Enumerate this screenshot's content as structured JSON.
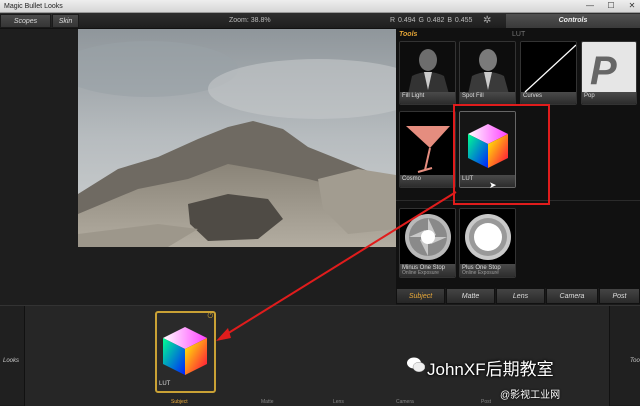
{
  "window": {
    "title": "Magic Bullet Looks",
    "minimize_glyph": "—",
    "maximize_glyph": "☐",
    "close_glyph": "✕"
  },
  "toolbar": {
    "scopes_label": "Scopes",
    "skin_label": "Skin",
    "zoom_text": "Zoom: 38.8%",
    "rgb_text": "R 0.494  G 0.482  B 0.455",
    "controls_label": "Controls"
  },
  "tools": {
    "header": "Tools",
    "lut_tag": "LUT",
    "items": [
      {
        "label": "Fill Light",
        "icon": "man-silhouette-icon"
      },
      {
        "label": "Spot Fill",
        "icon": "man-silhouette-icon"
      },
      {
        "label": "Curves",
        "icon": "curve-line-icon"
      },
      {
        "label": "Pop",
        "icon": "letter-p-icon"
      },
      {
        "label": "Cosmo",
        "icon": "martini-glass-icon"
      },
      {
        "label": "LUT",
        "icon": "color-cube-icon"
      },
      {
        "label": "Minus One Stop",
        "sub": "Online Exposure",
        "icon": "aperture-icon"
      },
      {
        "label": "Plus One Stop",
        "sub": "Online Exposure",
        "icon": "aperture-bright-icon"
      }
    ]
  },
  "tabs": [
    "Subject",
    "Matte",
    "Lens",
    "Camera",
    "Post"
  ],
  "looks": {
    "label": "Looks",
    "tools_label": "Too",
    "slot_label": "LUT",
    "strip": [
      "Subject",
      "Matte",
      "Lens",
      "Camera",
      "Post"
    ]
  },
  "watermark": {
    "main": "JohnXF后期教室",
    "secondary": "@影视工业网"
  },
  "colors": {
    "accent": "#e9a93a",
    "annotation": "#e01c1c"
  }
}
